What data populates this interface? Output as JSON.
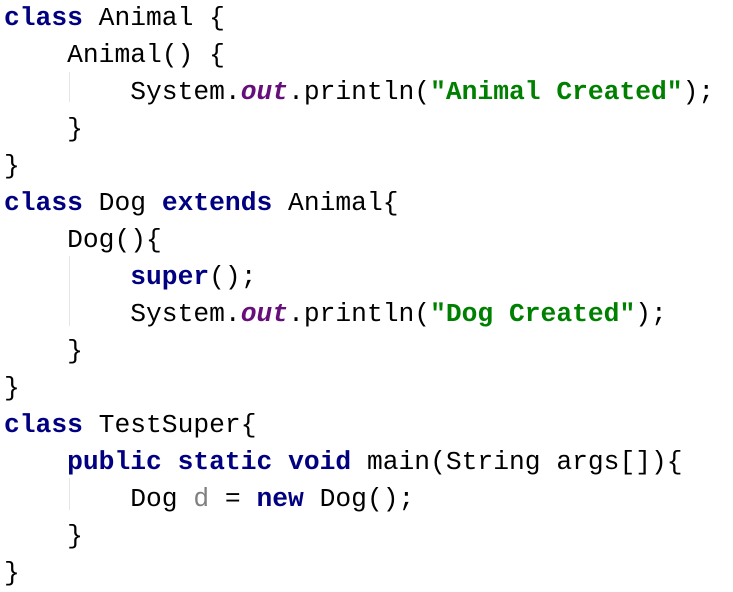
{
  "editor": {
    "lines": [
      [
        {
          "t": "kw",
          "v": "class"
        },
        {
          "t": "plain",
          "v": " Animal {"
        }
      ],
      [
        {
          "t": "plain",
          "v": "    Animal() {"
        }
      ],
      [
        {
          "t": "plain",
          "v": "        System."
        },
        {
          "t": "field",
          "v": "out"
        },
        {
          "t": "plain",
          "v": ".println("
        },
        {
          "t": "str",
          "v": "\"Animal Created\""
        },
        {
          "t": "plain",
          "v": ");"
        }
      ],
      [
        {
          "t": "plain",
          "v": "    }"
        }
      ],
      [
        {
          "t": "plain",
          "v": "}"
        }
      ],
      [
        {
          "t": "kw",
          "v": "class"
        },
        {
          "t": "plain",
          "v": " Dog "
        },
        {
          "t": "kw",
          "v": "extends"
        },
        {
          "t": "plain",
          "v": " Animal{"
        }
      ],
      [
        {
          "t": "plain",
          "v": "    Dog(){"
        }
      ],
      [
        {
          "t": "plain",
          "v": "        "
        },
        {
          "t": "kw",
          "v": "super"
        },
        {
          "t": "plain",
          "v": "();"
        }
      ],
      [
        {
          "t": "plain",
          "v": "        System."
        },
        {
          "t": "field",
          "v": "out"
        },
        {
          "t": "plain",
          "v": ".println("
        },
        {
          "t": "str",
          "v": "\"Dog Created\""
        },
        {
          "t": "plain",
          "v": ");"
        }
      ],
      [
        {
          "t": "plain",
          "v": "    }"
        }
      ],
      [
        {
          "t": "plain",
          "v": "}"
        }
      ],
      [
        {
          "t": "kw",
          "v": "class"
        },
        {
          "t": "plain",
          "v": " TestSuper{"
        }
      ],
      [
        {
          "t": "plain",
          "v": "    "
        },
        {
          "t": "kw",
          "v": "public"
        },
        {
          "t": "plain",
          "v": " "
        },
        {
          "t": "kw",
          "v": "static"
        },
        {
          "t": "plain",
          "v": " "
        },
        {
          "t": "kw",
          "v": "void"
        },
        {
          "t": "plain",
          "v": " main(String args[]){"
        }
      ],
      [
        {
          "t": "plain",
          "v": "        Dog "
        },
        {
          "t": "unused",
          "v": "d"
        },
        {
          "t": "plain",
          "v": " = "
        },
        {
          "t": "kw",
          "v": "new"
        },
        {
          "t": "plain",
          "v": " Dog();"
        }
      ],
      [
        {
          "t": "plain",
          "v": "    }"
        }
      ],
      [
        {
          "t": "plain",
          "v": "}"
        }
      ]
    ]
  },
  "colors": {
    "keyword": "#000080",
    "field": "#660e7a",
    "string": "#008000",
    "unused": "#808080",
    "plain": "#000000",
    "background": "#ffffff"
  }
}
